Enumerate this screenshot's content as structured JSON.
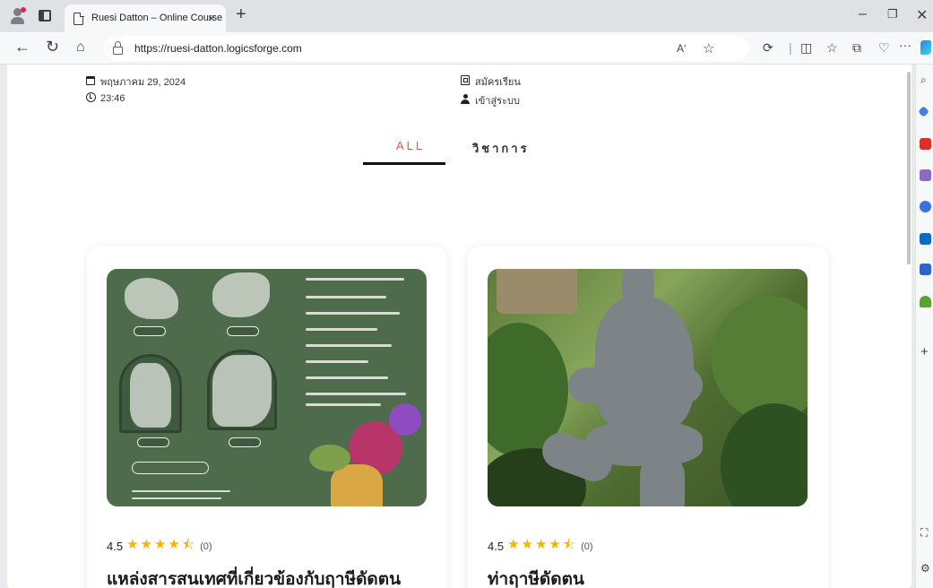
{
  "browser": {
    "tab_title": "Ruesi Datton – Online Course",
    "tab_close": "×",
    "new_tab": "+",
    "url": "https://ruesi-datton.logicsforge.com",
    "read_aloud": "Aʹ",
    "more": "···"
  },
  "header": {
    "date": "พฤษภาคม 29, 2024",
    "time": "23:46",
    "register": "สมัครเรียน",
    "login": "เข้าสู่ระบบ"
  },
  "filters": {
    "tabs": [
      {
        "label": "ALL",
        "active": true
      },
      {
        "label": "วิชาการ",
        "active": false
      }
    ]
  },
  "courses": [
    {
      "rating": "4.5",
      "stars": "★★★★⯪",
      "review_count": "(0)",
      "title": "แหล่งสารสนเทศที่เกี่ยวข้องกับฤาษีดัดตน",
      "image": "green-infographic-thumbnail"
    },
    {
      "rating": "4.5",
      "stars": "★★★★⯪",
      "review_count": "(0)",
      "title": "ท่าฤาษีดัดตน",
      "image": "statue-photo-thumbnail"
    }
  ],
  "colors": {
    "accent": "#e0564d",
    "star": "#f4b400",
    "text": "#1b1b1b"
  }
}
